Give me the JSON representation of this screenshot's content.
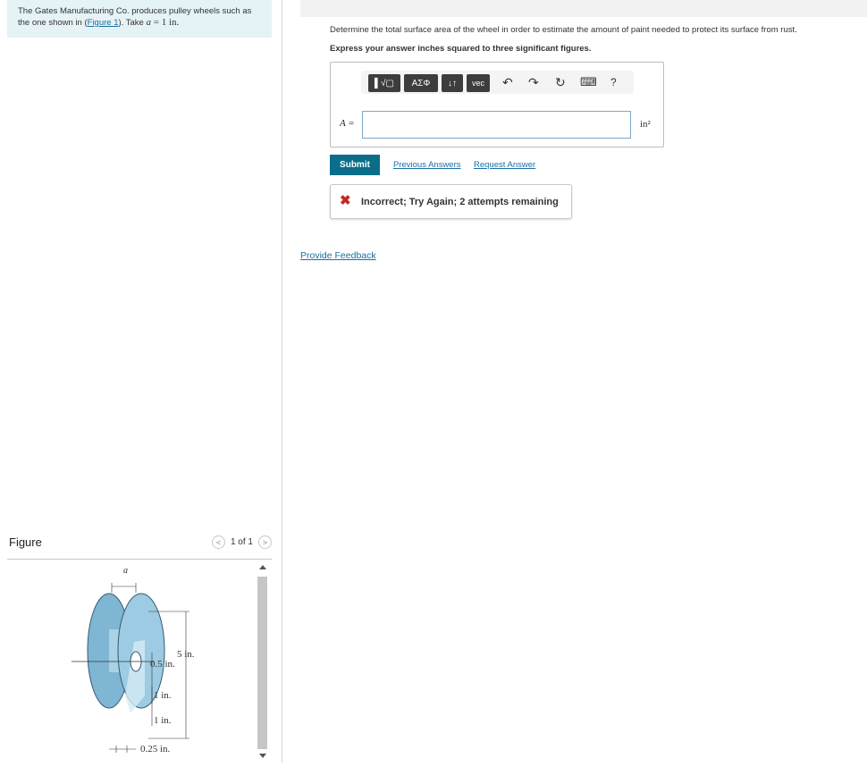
{
  "problem": {
    "text_before": "The Gates Manufacturing Co. produces pulley wheels such as the one shown in (",
    "figure_link": "Figure 1",
    "text_after": "). Take ",
    "var": "a",
    "eq": " = 1 ",
    "unit": "in."
  },
  "figure": {
    "title": "Figure",
    "pager": "1 of 1",
    "labels": {
      "a": "a",
      "five": "5 in.",
      "half": "0.5 in.",
      "one_a": "1 in.",
      "one_b": "1 in.",
      "quarter": "0.25 in."
    }
  },
  "question": {
    "prompt": "Determine the total surface area of the wheel in order to estimate the amount of paint needed to protect its surface from rust.",
    "instruction": "Express your answer inches squared to three significant figures."
  },
  "toolbar": {
    "templates": "▌√▢",
    "greek": "ΑΣΦ",
    "arrows": "↓↑",
    "vec": "vec",
    "undo": "↶",
    "redo": "↷",
    "reset": "↻",
    "keyboard": "⌨",
    "help": "?"
  },
  "answer": {
    "label": "A =",
    "value": "",
    "unit": "in²"
  },
  "actions": {
    "submit": "Submit",
    "previous": "Previous Answers",
    "request": "Request Answer",
    "provide_feedback": "Provide Feedback"
  },
  "feedback": {
    "icon": "close-icon",
    "text": "Incorrect; Try Again; 2 attempts remaining",
    "color": "#c62828"
  },
  "colors": {
    "accent": "#0a6e8a",
    "link": "#1a6fa0",
    "problem_bg": "#e6f3f6"
  }
}
